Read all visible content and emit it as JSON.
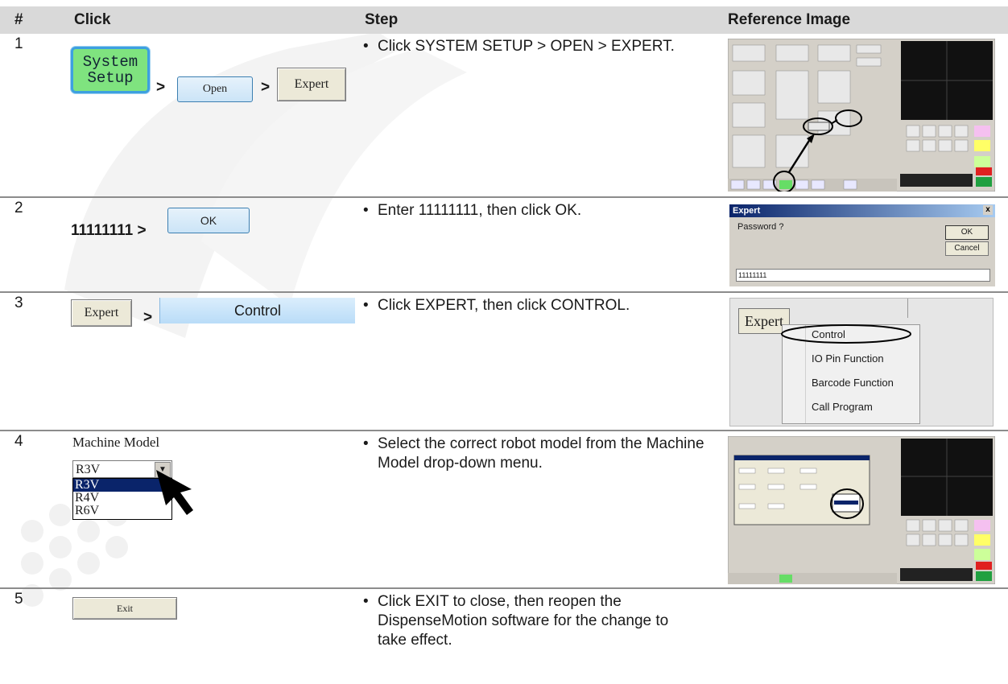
{
  "header": {
    "col_num": "#",
    "col_click": "Click",
    "col_step": "Step",
    "col_ref": "Reference Image"
  },
  "rows": [
    {
      "num": "1",
      "sys_line1": "System",
      "sys_line2": "Setup",
      "sep": ">",
      "open_label": "Open",
      "expert_label": "Expert",
      "step": "Click SYSTEM SETUP > OPEN > EXPERT."
    },
    {
      "num": "2",
      "code": "11111111 >",
      "ok_label": "OK",
      "step": "Enter 11111111, then click OK.",
      "dialog": {
        "title": "Expert",
        "close": "x",
        "prompt": "Password ?",
        "ok": "OK",
        "cancel": "Cancel",
        "value": "11111111"
      }
    },
    {
      "num": "3",
      "expert_label": "Expert",
      "sep": ">",
      "control_label": "Control",
      "step": "Click EXPERT, then click CONTROL.",
      "menu": {
        "button": "Expert",
        "items": [
          "Control",
          "IO Pin Function",
          "Barcode Function",
          "Call Program"
        ]
      }
    },
    {
      "num": "4",
      "label": "Machine Model",
      "selected": "R3V",
      "options": [
        "R3V",
        "R4V",
        "R6V"
      ],
      "step": "Select the correct robot model from the Machine Model drop-down menu."
    },
    {
      "num": "5",
      "exit_label": "Exit",
      "step": "Click EXIT to close, then reopen the DispenseMotion software for the change to take effect."
    }
  ],
  "colors": {
    "header_bg": "#d9d9d9",
    "rule": "#8c8c8c",
    "sys_button": "#7fe37f",
    "highlight": "#0a246a"
  }
}
